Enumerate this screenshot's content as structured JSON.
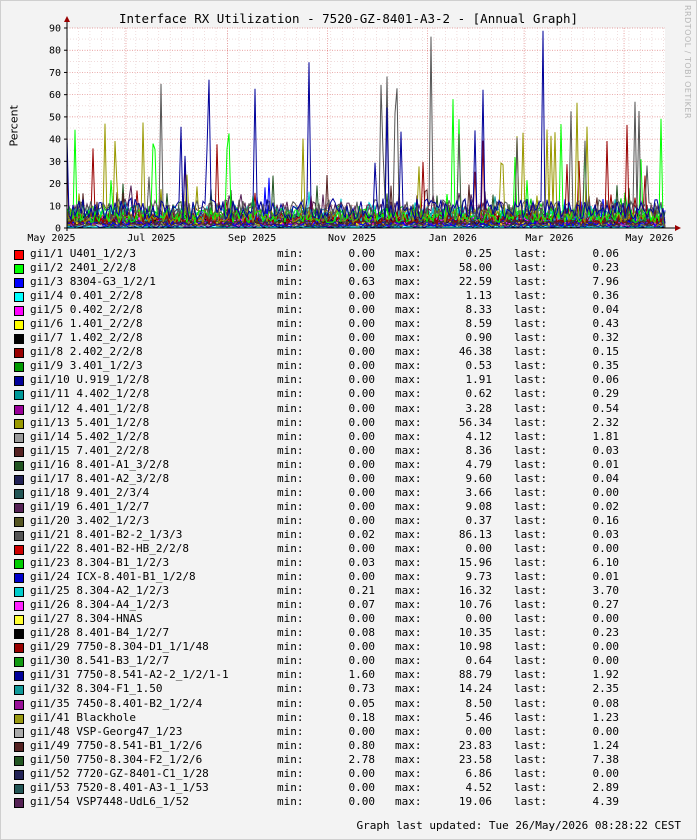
{
  "chart_data": {
    "type": "line",
    "title": "Interface RX Utilization - 7520-GZ-8401-A3-2 - [Annual Graph]",
    "ylabel": "Percent",
    "ylim": [
      0,
      90
    ],
    "yticks": [
      0,
      10,
      20,
      30,
      40,
      50,
      60,
      70,
      80,
      90
    ],
    "xlim": [
      "2025-05-26",
      "2026-05-26"
    ],
    "xticks": [
      {
        "label": "May 2025",
        "date": "2025-05-01"
      },
      {
        "label": "Jul 2025",
        "date": "2025-07-01"
      },
      {
        "label": "Sep 2025",
        "date": "2025-09-01"
      },
      {
        "label": "Nov 2025",
        "date": "2025-11-01"
      },
      {
        "label": "Jan 2026",
        "date": "2026-01-01"
      },
      {
        "label": "Mar 2026",
        "date": "2026-03-01"
      },
      {
        "label": "May 2026",
        "date": "2026-05-01"
      }
    ],
    "grid": true,
    "series": [
      {
        "name": "gi1/1 U401_1/2/3",
        "color": "#ff0000",
        "min": "0.00",
        "max": "0.25",
        "last": "0.06"
      },
      {
        "name": "gi1/2 2401_2/2/8",
        "color": "#00ff00",
        "min": "0.00",
        "max": "58.00",
        "last": "0.23"
      },
      {
        "name": "gi1/3 8304-G3_1/2/1",
        "color": "#0000ff",
        "min": "0.63",
        "max": "22.59",
        "last": "7.96"
      },
      {
        "name": "gi1/4 0.401_2/2/8",
        "color": "#00ffff",
        "min": "0.00",
        "max": "1.13",
        "last": "0.36"
      },
      {
        "name": "gi1/5 0.402_2/2/8",
        "color": "#ff00ff",
        "min": "0.00",
        "max": "8.33",
        "last": "0.04"
      },
      {
        "name": "gi1/6 1.401_2/2/8",
        "color": "#ffff00",
        "min": "0.00",
        "max": "8.59",
        "last": "0.43"
      },
      {
        "name": "gi1/7 1.402_2/2/8",
        "color": "#000000",
        "min": "0.00",
        "max": "0.90",
        "last": "0.32"
      },
      {
        "name": "gi1/8 2.402_2/2/8",
        "color": "#990000",
        "min": "0.00",
        "max": "46.38",
        "last": "0.15"
      },
      {
        "name": "gi1/9 3.401_1/2/3",
        "color": "#009900",
        "min": "0.00",
        "max": "0.53",
        "last": "0.35"
      },
      {
        "name": "gi1/10 U.919_1/2/8",
        "color": "#000099",
        "min": "0.00",
        "max": "1.91",
        "last": "0.06"
      },
      {
        "name": "gi1/11 4.402_1/2/8",
        "color": "#009999",
        "min": "0.00",
        "max": "0.62",
        "last": "0.29"
      },
      {
        "name": "gi1/12 4.401_1/2/8",
        "color": "#990099",
        "min": "0.00",
        "max": "3.28",
        "last": "0.54"
      },
      {
        "name": "gi1/13 5.401_1/2/8",
        "color": "#999900",
        "min": "0.00",
        "max": "56.34",
        "last": "2.32"
      },
      {
        "name": "gi1/14 5.402_1/2/8",
        "color": "#999999",
        "min": "0.00",
        "max": "4.12",
        "last": "1.81"
      },
      {
        "name": "gi1/15 7.401_2/2/8",
        "color": "#552222",
        "min": "0.00",
        "max": "8.36",
        "last": "0.03"
      },
      {
        "name": "gi1/16 8.401-A1_3/2/8",
        "color": "#225522",
        "min": "0.00",
        "max": "4.79",
        "last": "0.01"
      },
      {
        "name": "gi1/17 8.401-A2_3/2/8",
        "color": "#222255",
        "min": "0.00",
        "max": "9.60",
        "last": "0.04"
      },
      {
        "name": "gi1/18 9.401_2/3/4",
        "color": "#225555",
        "min": "0.00",
        "max": "3.66",
        "last": "0.00"
      },
      {
        "name": "gi1/19 6.401_1/2/7",
        "color": "#552255",
        "min": "0.00",
        "max": "9.08",
        "last": "0.02"
      },
      {
        "name": "gi1/20 3.402_1/2/3",
        "color": "#555522",
        "min": "0.00",
        "max": "0.37",
        "last": "0.16"
      },
      {
        "name": "gi1/21 8.401-B2-2_1/3/3",
        "color": "#555555",
        "min": "0.02",
        "max": "86.13",
        "last": "0.03"
      },
      {
        "name": "gi1/22 8.401-B2-HB_2/2/8",
        "color": "#cc0000",
        "min": "0.00",
        "max": "0.00",
        "last": "0.00"
      },
      {
        "name": "gi1/23 8.304-B1_1/2/3",
        "color": "#00cc00",
        "min": "0.03",
        "max": "15.96",
        "last": "6.10"
      },
      {
        "name": "gi1/24 ICX-8.401-B1_1/2/8",
        "color": "#0000cc",
        "min": "0.00",
        "max": "9.73",
        "last": "0.01"
      },
      {
        "name": "gi1/25 8.304-A2_1/2/3",
        "color": "#00cccc",
        "min": "0.21",
        "max": "16.32",
        "last": "3.70"
      },
      {
        "name": "gi1/26 8.304-A4_1/2/3",
        "color": "#ff22ff",
        "min": "0.07",
        "max": "10.76",
        "last": "0.27"
      },
      {
        "name": "gi1/27 8.304-HNAS",
        "color": "#ffff33",
        "min": "0.00",
        "max": "0.00",
        "last": "0.00"
      },
      {
        "name": "gi1/28 8.401-B4_1/2/7",
        "color": "#000000",
        "min": "0.08",
        "max": "10.35",
        "last": "0.23"
      },
      {
        "name": "gi1/29 7750-8.304-D1_1/1/48",
        "color": "#990000",
        "min": "0.00",
        "max": "10.98",
        "last": "0.00"
      },
      {
        "name": "gi1/30 8.541-B3_1/2/7",
        "color": "#119911",
        "min": "0.00",
        "max": "0.64",
        "last": "0.00"
      },
      {
        "name": "gi1/31 7750-8.541-A2-2_1/2/1-1",
        "color": "#000099",
        "min": "1.60",
        "max": "88.79",
        "last": "1.92"
      },
      {
        "name": "gi1/32 8.304-F1_1.50",
        "color": "#119999",
        "min": "0.73",
        "max": "14.24",
        "last": "2.35"
      },
      {
        "name": "gi1/35 7450-8.401-B2_1/2/4",
        "color": "#991199",
        "min": "0.05",
        "max": "8.50",
        "last": "0.08"
      },
      {
        "name": "gi1/41 Blackhole",
        "color": "#999911",
        "min": "0.18",
        "max": "5.46",
        "last": "1.23"
      },
      {
        "name": "gi1/48 VSP-Georg47_1/23",
        "color": "#aaaaaa",
        "min": "0.00",
        "max": "0.00",
        "last": "0.00"
      },
      {
        "name": "gi1/49 7750-8.541-B1_1/2/6",
        "color": "#552222",
        "min": "0.80",
        "max": "23.83",
        "last": "1.24"
      },
      {
        "name": "gi1/50 7750-8.304-F2_1/2/6",
        "color": "#225522",
        "min": "2.78",
        "max": "23.58",
        "last": "7.38"
      },
      {
        "name": "gi1/52 7720-GZ-8401-C1_1/28",
        "color": "#222255",
        "min": "0.00",
        "max": "6.86",
        "last": "0.00"
      },
      {
        "name": "gi1/53 7520-8.401-A3-1_1/53",
        "color": "#225555",
        "min": "0.00",
        "max": "4.52",
        "last": "2.89"
      },
      {
        "name": "gi1/54 VSP7448-UdL6_1/52",
        "color": "#552255",
        "min": "0.00",
        "max": "19.06",
        "last": "4.39"
      }
    ]
  },
  "legend_labels": {
    "min": "min:",
    "max": "max:",
    "last": "last:"
  },
  "vendor": "RRDTOOL / TOBI OETIKER",
  "updated": "Graph last updated: Tue 26/May/2026 08:28:22 CEST"
}
